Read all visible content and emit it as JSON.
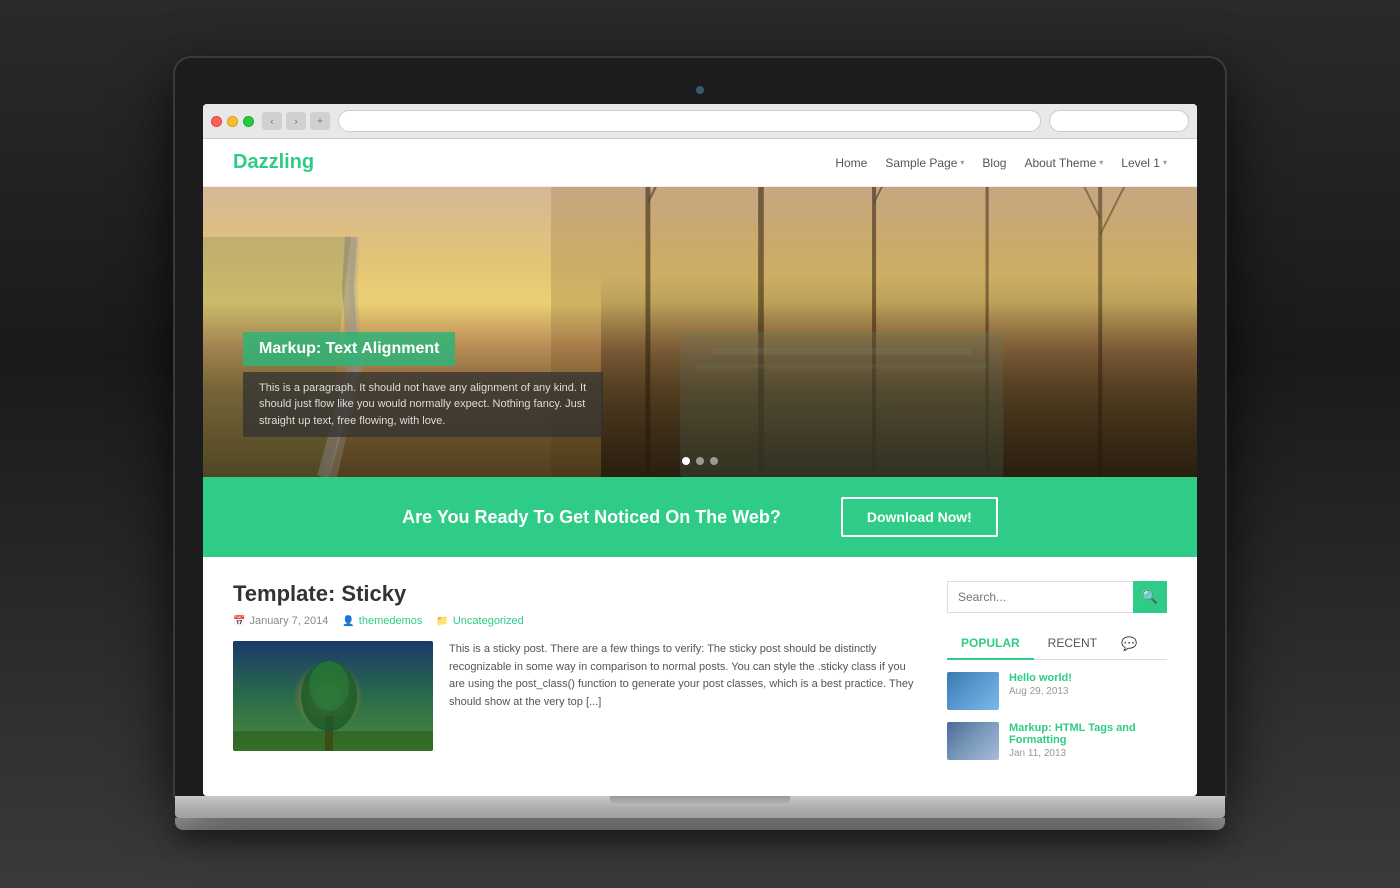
{
  "laptop": {
    "camera_dot": "camera"
  },
  "browser": {
    "address_value": "",
    "address_placeholder": "",
    "search_placeholder": ""
  },
  "site": {
    "logo": "Dazzling",
    "nav": {
      "links": [
        {
          "label": "Home",
          "has_dropdown": false
        },
        {
          "label": "Sample Page",
          "has_dropdown": true
        },
        {
          "label": "Blog",
          "has_dropdown": false
        },
        {
          "label": "About Theme",
          "has_dropdown": true
        },
        {
          "label": "Level 1",
          "has_dropdown": true
        }
      ]
    },
    "hero": {
      "title": "Markup: Text Alignment",
      "description": "This is a paragraph. It should not have any alignment of any kind. It should just flow like you would normally expect. Nothing fancy. Just straight up text, free flowing, with love.",
      "dots": [
        {
          "active": true
        },
        {
          "active": false
        },
        {
          "active": false
        }
      ]
    },
    "cta": {
      "text": "Are You Ready To Get Noticed On The Web?",
      "button_label": "Download Now!"
    },
    "main": {
      "post": {
        "title": "Template: Sticky",
        "meta_date": "January 7, 2014",
        "meta_author": "themedemos",
        "meta_category": "Uncategorized",
        "excerpt": "This is a sticky post. There are a few things to verify: The sticky post should be distinctly recognizable in some way in comparison to normal posts. You can style the .sticky class if you are using the post_class() function to generate your post classes, which is a best practice. They should show at the very top [...]"
      },
      "sidebar": {
        "search_placeholder": "Search...",
        "search_btn_icon": "🔍",
        "tabs": [
          {
            "label": "POPULAR",
            "active": true
          },
          {
            "label": "RECENT",
            "active": false
          },
          {
            "label": "💬",
            "active": false,
            "is_icon": true
          }
        ],
        "posts": [
          {
            "title": "Hello world!",
            "date": "Aug 29, 2013",
            "thumb_type": "hello"
          },
          {
            "title": "Markup: HTML Tags and Formatting",
            "date": "Jan 11, 2013",
            "thumb_type": "markup"
          }
        ]
      }
    }
  }
}
